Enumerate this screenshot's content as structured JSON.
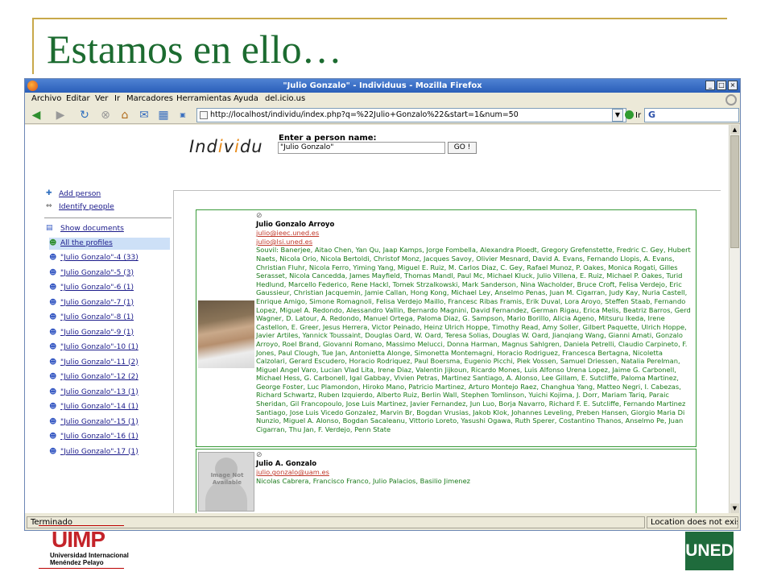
{
  "slide": {
    "title": "Estamos en ello…"
  },
  "window": {
    "title": "\"Julio Gonzalo\" - Individuus - Mozilla Firefox",
    "buttons": [
      "_",
      "□",
      "×"
    ]
  },
  "menu": [
    "Archivo",
    "Editar",
    "Ver",
    "Ir",
    "Marcadores",
    "Herramientas",
    "Ayuda",
    "del.icio.us"
  ],
  "toolbar": {
    "url": "http://localhost/individu/index.php?q=%22Julio+Gonzalo%22&start=1&num=50",
    "go_label": "Ir",
    "search_placeholder": "G"
  },
  "status": {
    "left": "Terminado",
    "right": "Location does not exist."
  },
  "page": {
    "logo_parts": [
      "Ind",
      "i",
      "v",
      "i",
      "du"
    ],
    "search_label": "Enter a person name:",
    "search_value": "\"Julio Gonzalo\"",
    "go_button": "GO !"
  },
  "sidebar": {
    "add_person": "Add person",
    "identify_people": "Identify people",
    "show_documents": "Show documents",
    "all_profiles": "All the profiles",
    "profiles": [
      "\"Julio Gonzalo\"-4 (33)",
      "\"Julio Gonzalo\"-5 (3)",
      "\"Julio Gonzalo\"-6 (1)",
      "\"Julio Gonzalo\"-7 (1)",
      "\"Julio Gonzalo\"-8 (1)",
      "\"Julio Gonzalo\"-9 (1)",
      "\"Julio Gonzalo\"-10 (1)",
      "\"Julio Gonzalo\"-11 (2)",
      "\"Julio Gonzalo\"-12 (2)",
      "\"Julio Gonzalo\"-13 (1)",
      "\"Julio Gonzalo\"-14 (1)",
      "\"Julio Gonzalo\"-15 (1)",
      "\"Julio Gonzalo\"-16 (1)",
      "\"Julio Gonzalo\"-17 (1)"
    ]
  },
  "results": [
    {
      "name": "Julio Gonzalo Arroyo",
      "emails": [
        "julio@ieec.uned.es",
        "julio@lsi.uned.es"
      ],
      "coauthors": "Souvil: Banerjee, Aitao Chen, Yan Qu, Jaap Kamps, Jorge Fombella, Alexandra Ploedt, Gregory Grefenstette, Fredric C. Gey, Hubert Naets, Nicola Orio, Nicola Bertoldi, Christof Monz, Jacques Savoy, Olivier Mesnard, David A. Evans, Fernando Llopis, A. Evans, Christian Fluhr, Nicola Ferro, Yiming Yang, Miguel E. Ruiz, M. Carlos Diaz, C. Gey, Rafael Munoz, P. Oakes, Monica Rogati, Gilles Serasset, Nicola Cancedda, James Mayfield, Thomas Mandl, Paul Mc, Michael Kluck, Julio Villena, E. Ruiz, Michael P. Oakes, Turid Hedlund, Marcello Federico, Rene Hackl, Tomek Strzalkowski, Mark Sanderson, Nina Wacholder, Bruce Croft, Felisa Verdejo, Eric Gaussieur, Christian Jacquemin, Jamie Callan, Hong Kong, Michael Ley, Anselmo Penas, Juan M. Cigarran, Judy Kay, Nuria Castell, Enrique Amigo, Simone Romagnoli, Felisa Verdejo Maillo, Francesc Ribas Framis, Erik Duval, Lora Aroyo, Steffen Staab, Fernando Lopez, Miguel A. Redondo, Alessandro Vallin, Bernardo Magnini, David Fernandez, German Rigau, Erica Melis, Beatriz Barros, Gerd Wagner, D. Latour, A. Redondo, Manuel Ortega, Paloma Diaz, G. Sampson, Mario Borillo, Alicia Ageno, Mitsuru Ikeda, Irene Castellon, E. Greer, Jesus Herrera, Victor Peinado, Heinz Ulrich Hoppe, Timothy Read, Amy Soller, Gilbert Paquette, Ulrich Hoppe, Javier Artiles, Yannick Toussaint, Douglas Oard, W. Oard, Teresa Solias, Douglas W. Oard, Jianqiang Wang, Gianni Amati, Gonzalo Arroyo, Roel Brand, Giovanni Romano, Massimo Melucci, Donna Harman, Magnus Sahlgren, Daniela Petrelli, Claudio Carpineto, F. Jones, Paul Clough, Tue Jan, Antonietta Alonge, Simonetta Montemagni, Horacio Rodriguez, Francesca Bertagna, Nicoletta Calzolari, Gerard Escudero, Horacio Rodriquez, Paul Boersma, Eugenio Picchi, Piek Vossen, Samuel Driessen, Natalia Perelman, Miguel Angel Varo, Lucian Vlad Lita, Irene Diaz, Valentin Jijkoun, Ricardo Mones, Luis Alfonso Urena Lopez, Jaime G. Carbonell, Michael Hess, G. Carbonell, Igal Gabbay, Vivien Petras, Martinez Santiago, A. Alonso, Lee Gillam, E. Sutcliffe, Paloma Martinez, George Foster, Luc Plamondon, Hiroko Mano, Patricio Martinez, Arturo Montejo Raez, Changhua Yang, Matteo Negri, I. Cabezas, Richard Schwartz, Ruben Izquierdo, Alberto Ruiz, Berlin Wall, Stephen Tomlinson, Yuichi Kojima, J. Dorr, Mariam Tariq, Paraic Sheridan, Gil Francopoulo, Jose Luis Martinez, Javier Fernandez, Jun Luo, Borja Navarro, Richard F. E. Sutcliffe, Fernando Martinez Santiago, Jose Luis Vicedo Gonzalez, Marvin Br, Bogdan Vrusias, Jakob Klok, Johannes Leveling, Preben Hansen, Giorgio Maria Di Nunzio, Miguel A. Alonso, Bogdan Sacaleanu, Vittorio Loreto, Yasushi Ogawa, Ruth Sperer, Costantino Thanos, Anselmo Pe, Juan Cigarran, Thu Jan, F. Verdejo, Penn State"
    },
    {
      "name": "Julio A. Gonzalo",
      "emails": [
        "julio.gonzalo@uam.es"
      ],
      "coauthors": "Nicolas Cabrera, Francisco Franco, Julio Palacios, Basilio Jimenez",
      "photo_label": "Image Not Available"
    }
  ],
  "footer": {
    "uimp": "UIMP",
    "uimp_line1": "Universidad Internacional",
    "uimp_line2": "Menéndez Pelayo",
    "uned": "UNED"
  }
}
